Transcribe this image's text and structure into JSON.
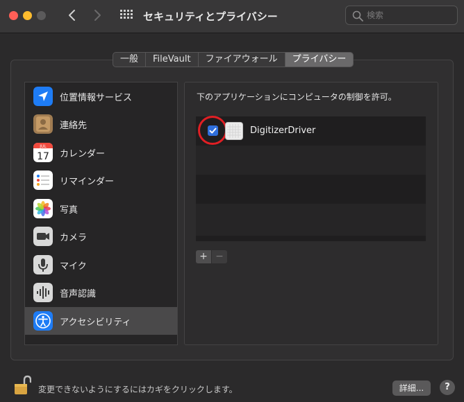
{
  "window": {
    "title": "セキュリティとプライバシー",
    "search_placeholder": "検索"
  },
  "tabs": [
    {
      "label": "一般",
      "active": false
    },
    {
      "label": "FileVault",
      "active": false
    },
    {
      "label": "ファイアウォール",
      "active": false
    },
    {
      "label": "プライバシー",
      "active": true
    }
  ],
  "sidebar": {
    "items": [
      {
        "label": "位置情報サービス",
        "icon": "location-arrow-icon"
      },
      {
        "label": "連絡先",
        "icon": "contacts-icon"
      },
      {
        "label": "カレンダー",
        "icon": "calendar-icon",
        "calendar_month": "JUL",
        "calendar_day": "17"
      },
      {
        "label": "リマインダー",
        "icon": "reminders-icon"
      },
      {
        "label": "写真",
        "icon": "photos-icon"
      },
      {
        "label": "カメラ",
        "icon": "camera-icon"
      },
      {
        "label": "マイク",
        "icon": "microphone-icon"
      },
      {
        "label": "音声認識",
        "icon": "speech-recognition-icon"
      },
      {
        "label": "アクセシビリティ",
        "icon": "accessibility-icon",
        "selected": true
      }
    ]
  },
  "main": {
    "heading": "下のアプリケーションにコンピュータの制御を許可。",
    "apps": [
      {
        "name": "DigitizerDriver",
        "checked": true,
        "icon": "app-grid-icon"
      }
    ],
    "add_label": "+",
    "remove_label": "−"
  },
  "footer": {
    "lock_text": "変更できないようにするにはカギをクリックします。",
    "details_label": "詳細...",
    "help_label": "?"
  },
  "colors": {
    "checkbox": "#2f6fdc",
    "highlight_ring": "#e01f24",
    "close": "#ff5f57",
    "minimize": "#febc2e"
  }
}
